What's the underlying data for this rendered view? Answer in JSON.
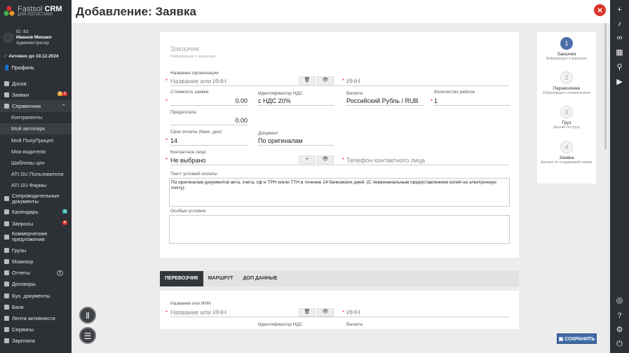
{
  "app": {
    "brand": "Fastsol",
    "brand_crm": "CRM",
    "subtitle": "ДЛЯ ЛОГИСТИКИ"
  },
  "user": {
    "id": "ID: 83",
    "name": "Иванов Михаил",
    "role": "Администратор"
  },
  "active_until": "Активно до 10.12.2024",
  "profile": "Профиль",
  "menu": {
    "doska": "Доска",
    "zayavki": "Заявки",
    "zayavki_b1": "5",
    "zayavki_b2": "1",
    "sprav": "Справочник",
    "kontr": "Контрагенты",
    "autopark": "Мой автопарк",
    "polupricep": "Мой ПолуПрицеп",
    "drivers": "Мои водители",
    "price": "Шаблоны цен",
    "ati_users": "ATI.SU Пользователи",
    "ati_firms": "ATI.SU Фирмы",
    "docs": "Сопроводительные документы",
    "calendar": "Календарь",
    "calendar_b": "1",
    "requests": "Запросы",
    "requests_b": "4",
    "offers": "Коммерческие предложения",
    "cargo": "Грузы",
    "monitor": "Мовизор",
    "reports": "Отчеты",
    "reports_b": "1",
    "contracts": "Договоры",
    "buh": "Бух. документы",
    "bank": "Банк",
    "activity": "Лента активности",
    "services": "Сервисы",
    "salary": "Зарплата"
  },
  "page": {
    "title": "Добавление: Заявка"
  },
  "form": {
    "section": "Заказчик",
    "section_sub": "Информация о заказчике",
    "org_label": "Название организации",
    "org_placeholder": "Название или ИНН",
    "inn_placeholder": "ИНН",
    "cost_label": "Стоимость заявки",
    "cost_value": "0.00",
    "vat_label": "Идентификатор НДС",
    "vat_value": "с НДС 20%",
    "currency_label": "Валюта",
    "currency_value": "Российский Рубль / RUB",
    "trips_label": "Количество рейсов",
    "trips_value": "1",
    "prepay_label": "Предоплата",
    "prepay_value": "0.00",
    "term_label": "Срок оплаты (банк. дни)",
    "term_value": "14",
    "doc_label": "Документ",
    "doc_value": "По оригиналам",
    "contact_label": "Контактное лицо",
    "contact_value": "Не выбрано",
    "phone_placeholder": "Телефон контактного лица",
    "terms_label": "Текст условий оплаты",
    "terms_value": "По оригиналам документов акта, счета, сф и ТРН и/или ТТН в течение 14 банковских дней. (С первоначальным предоставлением копий на электронную почту)",
    "special_label": "Особые условия",
    "special_value": "",
    "plus": "+"
  },
  "tabs": [
    "ПЕРЕВОЗЧИК",
    "МАРШРУТ",
    "ДОП ДАННЫЕ"
  ],
  "carrier": {
    "org_label": "Название или ИНН",
    "org_placeholder": "Название или ИНН",
    "inn_placeholder": "ИНН",
    "vat_label": "Идентификатор НДС",
    "currency_label": "Валюта"
  },
  "steps": [
    {
      "num": "1",
      "name": "Заказчик",
      "desc": "Информация о заказчике"
    },
    {
      "num": "2",
      "name": "Перевозчики",
      "desc": "Информация о перевозчиках"
    },
    {
      "num": "3",
      "name": "Груз",
      "desc": "Данные по грузу"
    },
    {
      "num": "4",
      "name": "Заявка",
      "desc": "Данные по создаваемой заявке"
    }
  ],
  "save": "СОХРАНИТЬ",
  "colors": {
    "accent": "#3f6aa3",
    "danger": "#d9342b",
    "sidebar": "#2d3035"
  }
}
